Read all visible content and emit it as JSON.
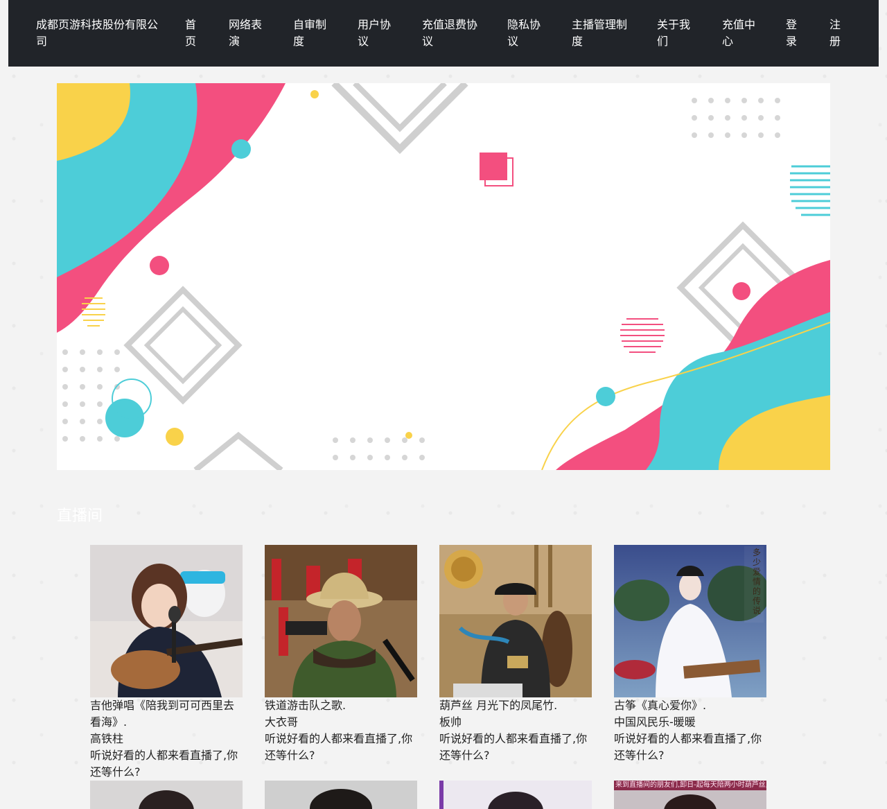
{
  "header": {
    "brand": "成都页游科技股份有限公司",
    "nav": [
      {
        "label": "首页"
      },
      {
        "label": "网络表演"
      },
      {
        "label": "自审制度"
      },
      {
        "label": "用户协议"
      },
      {
        "label": "充值退费协议"
      },
      {
        "label": "隐私协议"
      },
      {
        "label": "主播管理制度"
      },
      {
        "label": "关于我们"
      },
      {
        "label": "充值中心"
      },
      {
        "label": "登录"
      },
      {
        "label": "注册"
      }
    ]
  },
  "section": {
    "title": "直播间"
  },
  "rooms": [
    {
      "title": "吉他弹唱《陪我到可可西里去看海》.",
      "host": "高铁柱",
      "slogan": "听说好看的人都来看直播了,你还等什么?",
      "colors": [
        "#d9d3cf",
        "#1b2233"
      ]
    },
    {
      "title": "铁道游击队之歌.",
      "host": "大衣哥",
      "slogan": "听说好看的人都来看直播了,你还等什么?",
      "colors": [
        "#8a6a45",
        "#3f5b2c"
      ]
    },
    {
      "title": "葫芦丝 月光下的凤尾竹.",
      "host": "板帅",
      "slogan": "听说好看的人都来看直播了,你还等什么?",
      "colors": [
        "#a98a5c",
        "#2a2a2a"
      ]
    },
    {
      "title": "古筝《真心爱你》.",
      "host": "中国风民乐-暖暖",
      "slogan": "听说好看的人都来看直播了,你还等什么?",
      "colors": [
        "#5a6fa8",
        "#f4f4f8"
      ]
    }
  ],
  "thumb4_overlay": {
    "vertical_text": "多少爱情的传说",
    "banner_text": "来到直播间的朋友们,卸日-起每天陪两小时葫芦丝,弦"
  },
  "colors": {
    "topbar": "#212429",
    "pink": "#f34f7f",
    "cyan": "#4dcdd8",
    "yellow": "#f9d24a"
  }
}
